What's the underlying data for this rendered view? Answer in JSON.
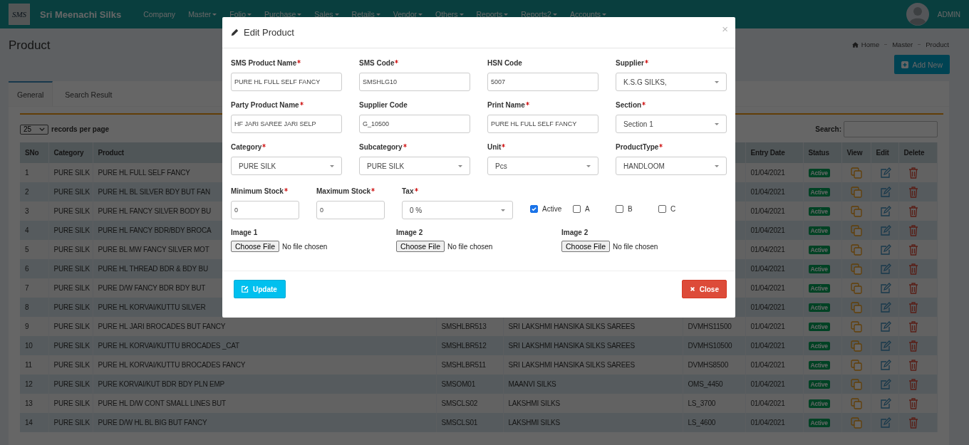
{
  "brand": {
    "monogram": "SMS",
    "name": "Sri Meenachi Silks"
  },
  "nav": [
    {
      "label": "Company",
      "dropdown": false
    },
    {
      "label": "Master",
      "dropdown": true
    },
    {
      "label": "Folio",
      "dropdown": true
    },
    {
      "label": "Purchase",
      "dropdown": true
    },
    {
      "label": "Sales",
      "dropdown": true
    },
    {
      "label": "Retails",
      "dropdown": true
    },
    {
      "label": "Vendor",
      "dropdown": true
    },
    {
      "label": "Others",
      "dropdown": true
    },
    {
      "label": "Reports",
      "dropdown": true
    },
    {
      "label": "Reports2",
      "dropdown": true
    },
    {
      "label": "Accounts",
      "dropdown": true
    }
  ],
  "user": {
    "name": "ADMIN"
  },
  "page": {
    "title": "Product",
    "breadcrumb": [
      "Home",
      "Master",
      "Product"
    ],
    "add_button": "Add New"
  },
  "tabs": [
    {
      "label": "General",
      "selected": true
    },
    {
      "label": "Search Result",
      "selected": false
    }
  ],
  "length_menu": {
    "value": "25",
    "label": "records per page"
  },
  "search": {
    "label": "Search:"
  },
  "table": {
    "columns": [
      "SNo",
      "Category",
      "Product",
      "Entry Date",
      "Status",
      "View",
      "Edit",
      "Delete"
    ],
    "rows": [
      {
        "sno": "1",
        "category": "PURE SILK",
        "product": "PURE HL FULL SELF FANCY",
        "entry_date": "01/04/2021",
        "status": "Active"
      },
      {
        "sno": "2",
        "category": "PURE SILK",
        "product": "PURE HL BL SILVER BDY BUT FAN",
        "entry_date": "01/04/2021",
        "status": "Active"
      },
      {
        "sno": "3",
        "category": "PURE SILK",
        "product": "PURE HL FANCY SILVER BODY BU",
        "entry_date": "01/04/2021",
        "status": "Active"
      },
      {
        "sno": "4",
        "category": "PURE SILK",
        "product": "PURE HL FANCY BDR/BDY BROCA",
        "entry_date": "01/04/2021",
        "status": "Active"
      },
      {
        "sno": "5",
        "category": "PURE SILK",
        "product": "PURE BL MW FANCY SILVER MOT",
        "entry_date": "01/04/2021",
        "status": "Active"
      },
      {
        "sno": "6",
        "category": "PURE SILK",
        "product": "PURE HL THREAD BDR & BDY BU",
        "entry_date": "01/04/2021",
        "status": "Active"
      },
      {
        "sno": "7",
        "category": "PURE SILK",
        "product": "PURE D/W FANCY BDR BDY BUT",
        "entry_date": "01/04/2021",
        "status": "Active"
      },
      {
        "sno": "8",
        "category": "PURE SILK",
        "product": "PURE HL KORVAI/KUTTU SILVER",
        "entry_date": "01/04/2021",
        "status": "Active"
      },
      {
        "sno": "9",
        "category": "PURE SILK",
        "product": "PURE HL JARI BROCADES BUT FANCY",
        "column_4": "SMSHLBR513",
        "column_5": "SRI LAKSHMI HANSIKA SILKS SAREES",
        "column_6": "DVMHS11500",
        "entry_date": "01/04/2021",
        "status": "Active"
      },
      {
        "sno": "10",
        "category": "PURE SILK",
        "product": "PURE HL KORVAI/KUTTU BROCADES _CAT",
        "column_4": "SMSHLBR512",
        "column_5": "SRI LAKSHMI HANSIKA SILKS SAREES",
        "column_6": "DVMHS10500",
        "entry_date": "01/04/2021",
        "status": "Active"
      },
      {
        "sno": "11",
        "category": "PURE SILK",
        "product": "PURE HL KORVAI/KUTTU BROCADES FANCY",
        "column_4": "SMSHLBR511",
        "column_5": "SRI LAKSHMI HANSIKA SILKS SAREES",
        "column_6": "DVMHS8500",
        "entry_date": "01/04/2021",
        "status": "Active"
      },
      {
        "sno": "12",
        "category": "PURE SILK",
        "product": "PURE KORVAI/KUT BDR BDY PLN EMP",
        "column_4": "SMSOM01",
        "column_5": "MAANVI SILKS",
        "column_6": "OMS_4450",
        "entry_date": "01/04/2021",
        "status": "Active"
      },
      {
        "sno": "13",
        "category": "PURE SILK",
        "product": "PURE HL D/W CONT SMALL LINES BUT",
        "column_4": "SMSCLS02",
        "column_5": "LAKSHMI SILKS",
        "column_6": "LS_3700",
        "entry_date": "01/04/2021",
        "status": "Active"
      },
      {
        "sno": "14",
        "category": "PURE SILK",
        "product": "PURE D/W HL BL BIG BUT FANCY",
        "column_4": "SMSCLS01",
        "column_5": "LAKSHMI SILKS",
        "column_6": "LS_4600",
        "entry_date": "01/04/2021",
        "status": "Active"
      }
    ]
  },
  "modal": {
    "title": "Edit Product",
    "close_glyph": "×",
    "fields": [
      {
        "label": "SMS Product Name",
        "required": true,
        "kind": "text",
        "value": "PURE HL FULL SELF FANCY"
      },
      {
        "label": "SMS Code",
        "required": true,
        "kind": "text",
        "value": "SMSHLG10"
      },
      {
        "label": "HSN Code",
        "required": false,
        "kind": "text",
        "value": "5007"
      },
      {
        "label": "Supplier",
        "required": true,
        "kind": "select",
        "value": "K.S.G SILKS,"
      },
      {
        "label": "Party Product Name",
        "required": true,
        "kind": "text",
        "value": "HF JARI SAREE JARI SELP"
      },
      {
        "label": "Supplier Code",
        "required": false,
        "kind": "text",
        "value": "G_10500"
      },
      {
        "label": "Print Name",
        "required": true,
        "kind": "text",
        "value": "PURE HL FULL SELF FANCY"
      },
      {
        "label": "Section",
        "required": true,
        "kind": "select",
        "value": "Section 1"
      },
      {
        "label": "Category",
        "required": true,
        "kind": "select",
        "value": "PURE SILK"
      },
      {
        "label": "Subcategory",
        "required": true,
        "kind": "select",
        "value": "PURE SILK"
      },
      {
        "label": "Unit",
        "required": true,
        "kind": "select",
        "value": "Pcs"
      },
      {
        "label": "ProductType",
        "required": true,
        "kind": "select",
        "value": "HANDLOOM"
      }
    ],
    "stock_fields": [
      {
        "label": "Minimum Stock",
        "required": true,
        "kind": "text",
        "value": "0"
      },
      {
        "label": "Maximum Stock",
        "required": true,
        "kind": "text",
        "value": "0"
      },
      {
        "label": "Tax",
        "required": true,
        "kind": "select",
        "value": "0 %"
      }
    ],
    "checkboxes": [
      {
        "label": "Active",
        "checked": true
      },
      {
        "label": "A",
        "checked": false
      },
      {
        "label": "B",
        "checked": false
      },
      {
        "label": "C",
        "checked": false
      }
    ],
    "files": [
      {
        "label": "Image 1",
        "button": "Choose File",
        "status": "No file chosen"
      },
      {
        "label": "Image 2",
        "button": "Choose File",
        "status": "No file chosen"
      },
      {
        "label": "Image 2",
        "button": "Choose File",
        "status": "No file chosen"
      }
    ],
    "buttons": [
      {
        "label": "Update",
        "kind": "primary"
      },
      {
        "label": "Close",
        "kind": "danger"
      }
    ]
  }
}
